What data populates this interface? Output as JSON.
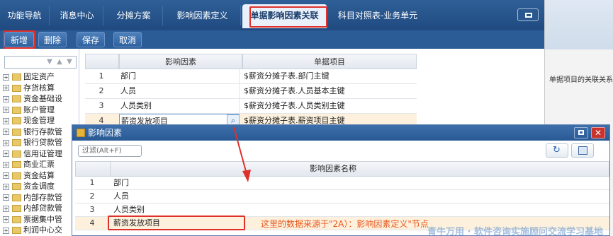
{
  "tabs": [
    {
      "label": "功能导航"
    },
    {
      "label": "消息中心"
    },
    {
      "label": "分摊方案"
    },
    {
      "label": "影响因素定义"
    },
    {
      "label": "单据影响因素关联"
    },
    {
      "label": "科目对照表-业务单元"
    }
  ],
  "toolbar": {
    "add": "新增",
    "delete": "删除",
    "save": "保存",
    "cancel": "取消"
  },
  "tree": {
    "items": [
      "固定资产",
      "存货核算",
      "资金基础设",
      "账户管理",
      "现金管理",
      "银行存款管",
      "银行贷款管",
      "信用证管理",
      "商业汇票",
      "资金结算",
      "资金调度",
      "内部存款管",
      "内部贷款管",
      "票据集中管",
      "利润中心交"
    ]
  },
  "grid": {
    "headers": {
      "factor": "影响因素",
      "item": "单据项目"
    },
    "rows": [
      {
        "no": "1",
        "factor": "部门",
        "item": "$薪资分摊子表.部门主键"
      },
      {
        "no": "2",
        "factor": "人员",
        "item": "$薪资分摊子表.人员基本主键"
      },
      {
        "no": "3",
        "factor": "人员类别",
        "item": "$薪资分摊子表.人员类别主键"
      },
      {
        "no": "4",
        "factor": "薪资发放项目",
        "item": "$薪资分摊子表.薪资项目主键"
      }
    ]
  },
  "right": {
    "text": "单据项目的关联关系"
  },
  "dialog": {
    "title": "影响因素",
    "filter_placeholder": "过滤(Alt+F)",
    "col": "影响因素名称",
    "rows": [
      {
        "no": "1",
        "name": "部门"
      },
      {
        "no": "2",
        "name": "人员"
      },
      {
        "no": "3",
        "name": "人员类别"
      },
      {
        "no": "4",
        "name": "薪资发放项目"
      }
    ]
  },
  "annotation": "这里的数据来源于\"2A）：影响因素定义\"节点",
  "watermark": "青牛万用 · 软件咨询实施顾问交流学习基地"
}
